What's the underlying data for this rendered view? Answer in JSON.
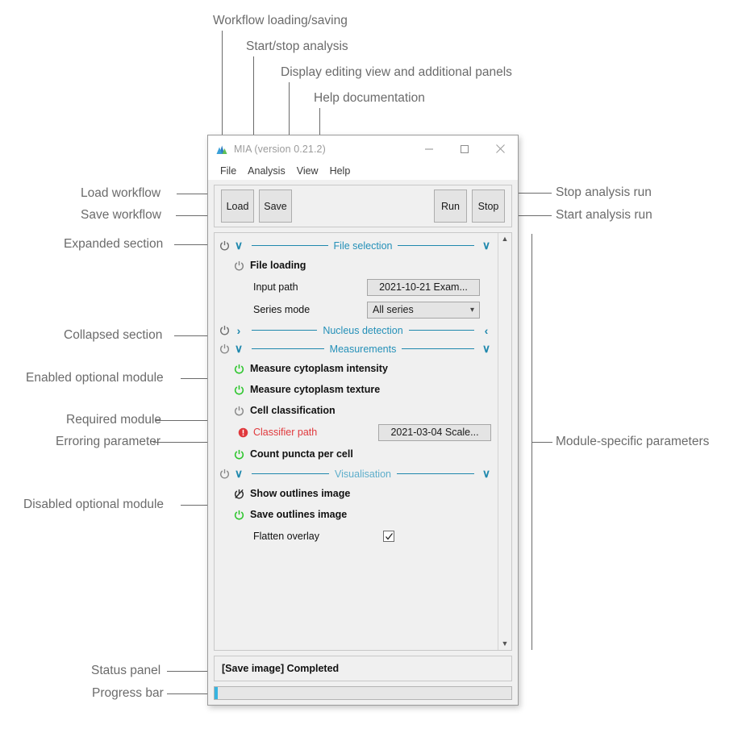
{
  "window": {
    "title": "MIA (version 0.21.2)",
    "logo_icon": "mia-mountain-logo",
    "controls": [
      {
        "name": "minimize-button",
        "icon": "minimize-icon"
      },
      {
        "name": "maximize-button",
        "icon": "maximize-icon"
      },
      {
        "name": "close-button",
        "icon": "close-icon"
      }
    ],
    "menu": [
      "File",
      "Analysis",
      "View",
      "Help"
    ]
  },
  "toolbar": {
    "load_label": "Load",
    "save_label": "Save",
    "run_label": "Run",
    "stop_label": "Stop"
  },
  "panel": {
    "scroll_up_icon": "chevron-up-icon",
    "scroll_down_icon": "chevron-down-icon",
    "sections": [
      {
        "title": "File selection",
        "state": "expanded",
        "chevron_left": "∨",
        "chevron_right": "∨",
        "power_icon": "power-icon-enabled",
        "rows": [
          {
            "kind": "module",
            "label": "File loading",
            "icon": "power-icon-required"
          },
          {
            "kind": "param",
            "label": "Input path",
            "control": "button",
            "value": "2021-10-21 Exam..."
          },
          {
            "kind": "param",
            "label": "Series mode",
            "control": "combo",
            "value": "All series"
          }
        ]
      },
      {
        "title": "Nucleus detection",
        "state": "collapsed",
        "chevron_left": "›",
        "chevron_right": "‹",
        "power_icon": "power-icon-enabled",
        "rows": []
      },
      {
        "title": "Measurements",
        "state": "expanded",
        "chevron_left": "∨",
        "chevron_right": "∨",
        "power_icon": "power-icon-required",
        "rows": [
          {
            "kind": "module",
            "label": "Measure cytoplasm intensity",
            "icon": "power-icon-enabled"
          },
          {
            "kind": "module",
            "label": "Measure cytoplasm texture",
            "icon": "power-icon-enabled"
          },
          {
            "kind": "module",
            "label": "Cell classification",
            "icon": "power-icon-required"
          },
          {
            "kind": "param-error",
            "label": "Classifier path",
            "control": "button",
            "value": "2021-03-04 Scale...",
            "icon": "error-icon"
          },
          {
            "kind": "module",
            "label": "Count puncta per cell",
            "icon": "power-icon-enabled"
          }
        ]
      },
      {
        "title": "Visualisation",
        "state": "expanded",
        "chevron_left": "∨",
        "chevron_right": "∨",
        "power_icon": "power-icon-required",
        "rows": [
          {
            "kind": "module",
            "label": "Show outlines image",
            "icon": "power-icon-disabled"
          },
          {
            "kind": "module",
            "label": "Save outlines image",
            "icon": "power-icon-enabled"
          },
          {
            "kind": "param",
            "label": "Flatten overlay",
            "control": "checkbox",
            "value": "checked"
          }
        ]
      }
    ]
  },
  "status": {
    "text": "[Save image] Completed",
    "progress_percent": 1
  },
  "annotations": {
    "top": [
      "Workflow loading/saving",
      "Start/stop analysis",
      "Display editing view and additional panels",
      "Help documentation"
    ],
    "left": [
      "Load workflow",
      "Save workflow",
      "Expanded section",
      "Collapsed section",
      "Enabled optional module",
      "Required module",
      "Erroring parameter",
      "Disabled optional module",
      "Status panel",
      "Progress bar"
    ],
    "right": [
      "Stop analysis run",
      "Start analysis run",
      "Module-specific parameters"
    ]
  },
  "colors": {
    "accent_blue": "#2490b8",
    "module_green": "#2fc62f",
    "module_gray": "#7a7a7a",
    "error_red": "#e0383c",
    "progress_blue": "#36b4e0"
  }
}
